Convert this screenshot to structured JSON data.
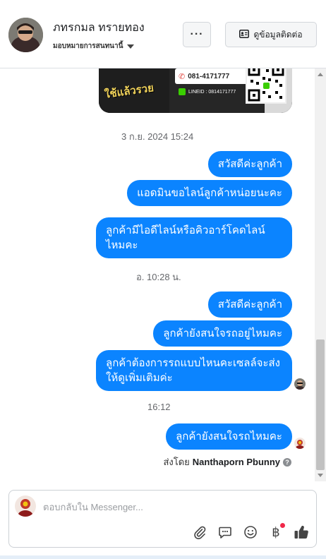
{
  "header": {
    "contact_name": "ภทรกมล ทรายทอง",
    "assignee_label": "มอบหมายการสนทนานี้",
    "more_label": "···",
    "view_info_label": "ดูข้อมูลติดต่อ"
  },
  "promo": {
    "chalk_text": "ใช้แล้วรวย",
    "phone": "081-4171777",
    "line_id": "LINEID : 0814171777"
  },
  "messages": {
    "ts1": "3 ก.ย. 2024 15:24",
    "m1": "สวัสดีค่ะลูกค้า",
    "m2": "แอดมินขอไลน์ลูกค้าหน่อยนะคะ",
    "m3": "ลูกค้ามีไอดีไลน์หรือคิวอาร์โคดไลน์ไหมคะ",
    "ts2": "อ. 10:28 น.",
    "m4": "สวัสดีค่ะลูกค้า",
    "m5": "ลูกค้ายังสนใจรถอยู่ไหมคะ",
    "m6": "ลูกค้าต้องการรถแบบไหนคะเซลล์จะส่งให้ดูเพิ่มเติมค่ะ",
    "ts3": "16:12",
    "m7": "ลูกค้ายังสนใจรถไหมคะ",
    "sent_by_prefix": "ส่งโดย",
    "sent_by_name": "Nanthaporn Pbunny",
    "help_mark": "?"
  },
  "composer": {
    "placeholder": "ตอบกลับใน Messenger..."
  },
  "colors": {
    "bubble": "#0b84ff",
    "timestamp": "#65676b",
    "border": "#dcdfe4"
  },
  "icons": [
    "attach-icon",
    "saved-reply-icon",
    "emoji-icon",
    "baht-icon",
    "thumbs-up-icon",
    "help-icon",
    "dropdown-caret-icon",
    "contact-card-icon"
  ]
}
